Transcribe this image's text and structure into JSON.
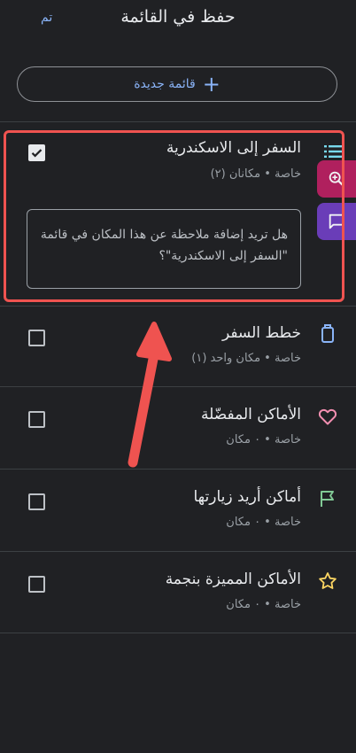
{
  "header": {
    "title": "حفظ في القائمة",
    "done_label": "تم"
  },
  "new_list": {
    "label": "قائمة جديدة"
  },
  "lists": [
    {
      "name": "السفر إلى الاسكندرية",
      "meta": "خاصة • مكانان (٢)",
      "checked": true,
      "icon": "list-icon",
      "icon_color": "#78d9ec"
    },
    {
      "name": "خطط السفر",
      "meta": "خاصة • مكان واحد (١)",
      "checked": false,
      "icon": "luggage-icon",
      "icon_color": "#8ab4f8"
    },
    {
      "name": "الأماكن المفضّلة",
      "meta": "خاصة • ٠ مكان",
      "checked": false,
      "icon": "heart-icon",
      "icon_color": "#f48fb1"
    },
    {
      "name": "أماكن أريد زيارتها",
      "meta": "خاصة • ٠ مكان",
      "checked": false,
      "icon": "flag-icon",
      "icon_color": "#81c995"
    },
    {
      "name": "الأماكن المميزة بنجمة",
      "meta": "خاصة • ٠ مكان",
      "checked": false,
      "icon": "star-icon",
      "icon_color": "#fdd663"
    }
  ],
  "note_prompt": "هل تريد إضافة ملاحظة عن هذا المكان في قائمة \"السفر إلى الاسكندرية\"؟",
  "side_actions": [
    {
      "icon": "zoom-icon",
      "color": "#b0205e"
    },
    {
      "icon": "chat-icon",
      "color": "#6a3db8"
    }
  ],
  "colors": {
    "background": "#202124",
    "accent": "#8ab4f8",
    "highlight": "#ef5350"
  }
}
